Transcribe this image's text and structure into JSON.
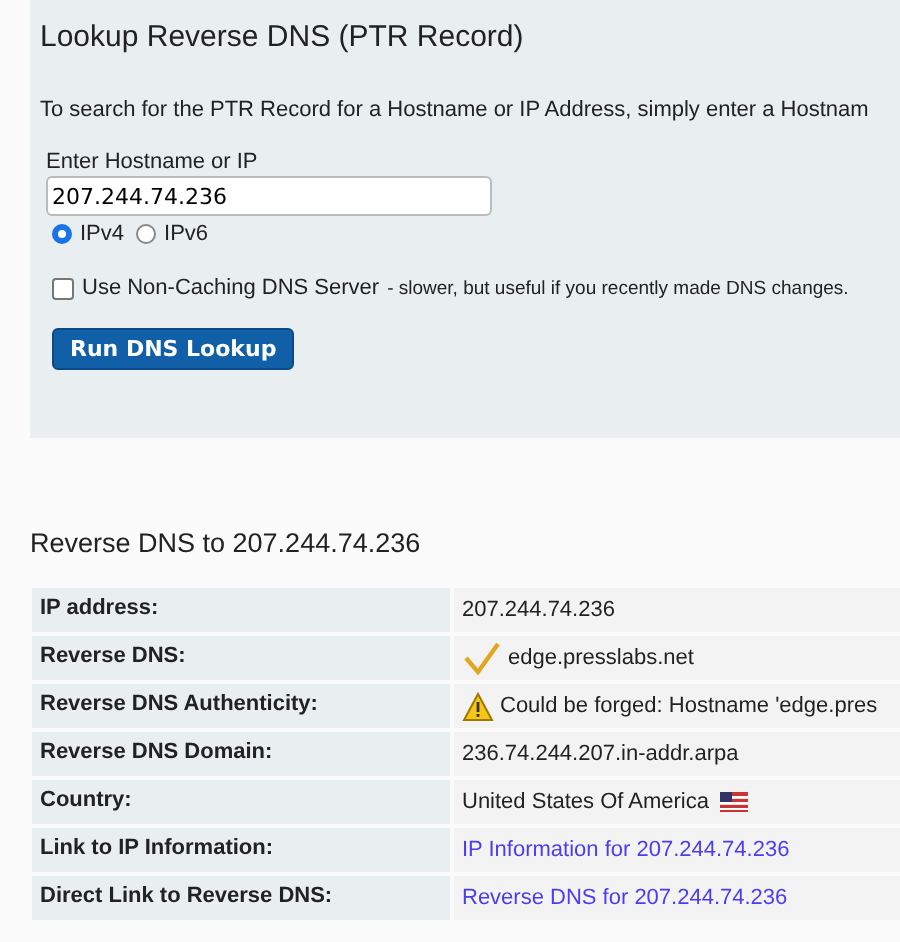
{
  "lookup_panel": {
    "title": "Lookup Reverse DNS (PTR Record)",
    "intro": "To search for the PTR Record for a Hostname or IP Address, simply enter a Hostnam",
    "field_label": "Enter Hostname or IP",
    "field_value": "207.244.74.236",
    "ip_versions": [
      {
        "label": "IPv4",
        "selected": true
      },
      {
        "label": "IPv6",
        "selected": false
      }
    ],
    "non_caching": {
      "label": "Use Non-Caching DNS Server",
      "note": "- slower, but useful if you recently made DNS changes.",
      "checked": false
    },
    "button": "Run DNS Lookup"
  },
  "results": {
    "title": "Reverse DNS to 207.244.74.236",
    "rows": [
      {
        "label": "IP address:",
        "value": "207.244.74.236",
        "kind": "text"
      },
      {
        "label": "Reverse DNS:",
        "value": "edge.presslabs.net",
        "kind": "check"
      },
      {
        "label": "Reverse DNS Authenticity:",
        "value": "Could be forged: Hostname 'edge.pres",
        "kind": "warning"
      },
      {
        "label": "Reverse DNS Domain:",
        "value": "236.74.244.207.in-addr.arpa",
        "kind": "text"
      },
      {
        "label": "Country:",
        "value": "United States Of America",
        "kind": "flag"
      },
      {
        "label": "Link to IP Information:",
        "value": "IP Information for 207.244.74.236",
        "kind": "link"
      },
      {
        "label": "Direct Link to Reverse DNS:",
        "value": "Reverse DNS for 207.244.74.236",
        "kind": "link"
      }
    ]
  }
}
